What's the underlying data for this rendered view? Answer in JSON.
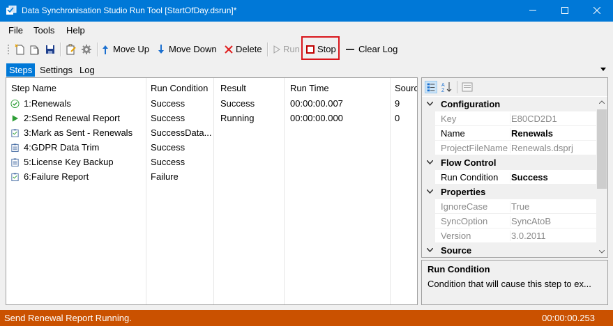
{
  "window": {
    "title": "Data Synchronisation Studio Run Tool [StartOfDay.dsrun]*",
    "colors": {
      "titlebar": "#0078d7",
      "statusbar": "#ca5100",
      "highlight": "#d9161c"
    }
  },
  "menu": {
    "file": "File",
    "tools": "Tools",
    "help": "Help"
  },
  "toolbar": {
    "icons": [
      "new-icon",
      "open-icon",
      "save-icon",
      "edit-icon",
      "settings-icon"
    ],
    "move_up": "Move Up",
    "move_down": "Move Down",
    "delete": "Delete",
    "run": "Run",
    "stop": "Stop",
    "clear_log": "Clear Log"
  },
  "tabs": [
    "Steps",
    "Settings",
    "Log"
  ],
  "steps": {
    "columns": [
      "Step Name",
      "Run Condition",
      "Result",
      "Run Time",
      "Sourc"
    ],
    "rows": [
      {
        "icon": "success-check-icon",
        "name": "1:Renewals",
        "condition": "Success",
        "result": "Success",
        "time": "00:00:00.007",
        "source": "9"
      },
      {
        "icon": "running-play-icon",
        "name": "2:Send Renewal Report",
        "condition": "Success",
        "result": "Running",
        "time": "00:00:00.000",
        "source": "0"
      },
      {
        "icon": "clipboard-icon",
        "name": "3:Mark as Sent - Renewals",
        "condition": "SuccessData...",
        "result": "",
        "time": "",
        "source": ""
      },
      {
        "icon": "clipboard-data-icon",
        "name": "4:GDPR Data Trim",
        "condition": "Success",
        "result": "",
        "time": "",
        "source": ""
      },
      {
        "icon": "clipboard-data-icon",
        "name": "5:License Key Backup",
        "condition": "Success",
        "result": "",
        "time": "",
        "source": ""
      },
      {
        "icon": "clipboard-icon",
        "name": "6:Failure Report",
        "condition": "Failure",
        "result": "",
        "time": "",
        "source": ""
      }
    ]
  },
  "properties": {
    "categories": [
      {
        "name": "Configuration",
        "items": [
          {
            "name": "Key",
            "value": "E80CD2D1",
            "readonly": true,
            "bold": false
          },
          {
            "name": "Name",
            "value": "Renewals",
            "readonly": false,
            "bold": true
          },
          {
            "name": "ProjectFileName",
            "value": "Renewals.dsprj",
            "readonly": true,
            "bold": false
          }
        ]
      },
      {
        "name": "Flow Control",
        "items": [
          {
            "name": "Run Condition",
            "value": "Success",
            "readonly": false,
            "bold": true
          }
        ]
      },
      {
        "name": "Properties",
        "items": [
          {
            "name": "IgnoreCase",
            "value": "True",
            "readonly": true,
            "bold": false
          },
          {
            "name": "SyncOption",
            "value": "SyncAtoB",
            "readonly": true,
            "bold": false
          },
          {
            "name": "Version",
            "value": "3.0.2011",
            "readonly": true,
            "bold": false
          }
        ]
      },
      {
        "name": "Source",
        "items": []
      }
    ],
    "description_title": "Run Condition",
    "description_text": "Condition that will cause this step to ex..."
  },
  "status": {
    "text": "Send Renewal Report Running.",
    "time": "00:00:00.253"
  }
}
